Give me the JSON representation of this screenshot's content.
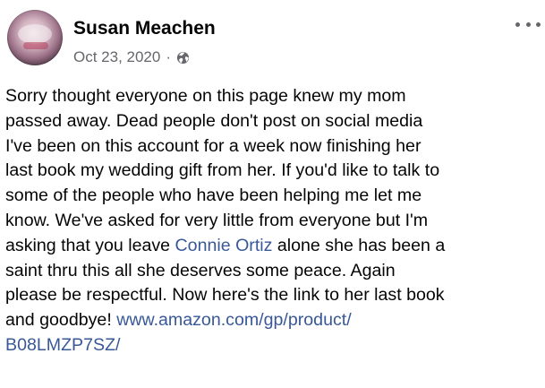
{
  "post": {
    "author": "Susan Meachen",
    "date": "Oct 23, 2020",
    "separator": "·",
    "audience_icon": "globe-icon",
    "more_icon": "more-options-icon",
    "text_lines": [
      "Sorry thought everyone on this page knew my mom",
      "passed away. Dead people don't post on social media",
      "I've been on this account for a week now finishing her",
      "last book my wedding gift from her. If you'd like to talk to",
      "some of the people who have been helping me let me",
      "know. We've asked for very little from everyone but I'm"
    ],
    "line7_before": "asking that you leave ",
    "mention": "Connie Ortiz",
    "line7_after": " alone she has been a",
    "line8": "saint thru this all she deserves some peace. Again",
    "line9": "please be respectful. Now here's the link to her last book",
    "line10_before": "and goodbye! ",
    "link_part1": "www.amazon.com/gp/product/",
    "link_part2": "B08LMZP7SZ/"
  },
  "colors": {
    "text": "#050505",
    "secondary": "#65676b",
    "link": "#385898",
    "background": "#ffffff"
  }
}
